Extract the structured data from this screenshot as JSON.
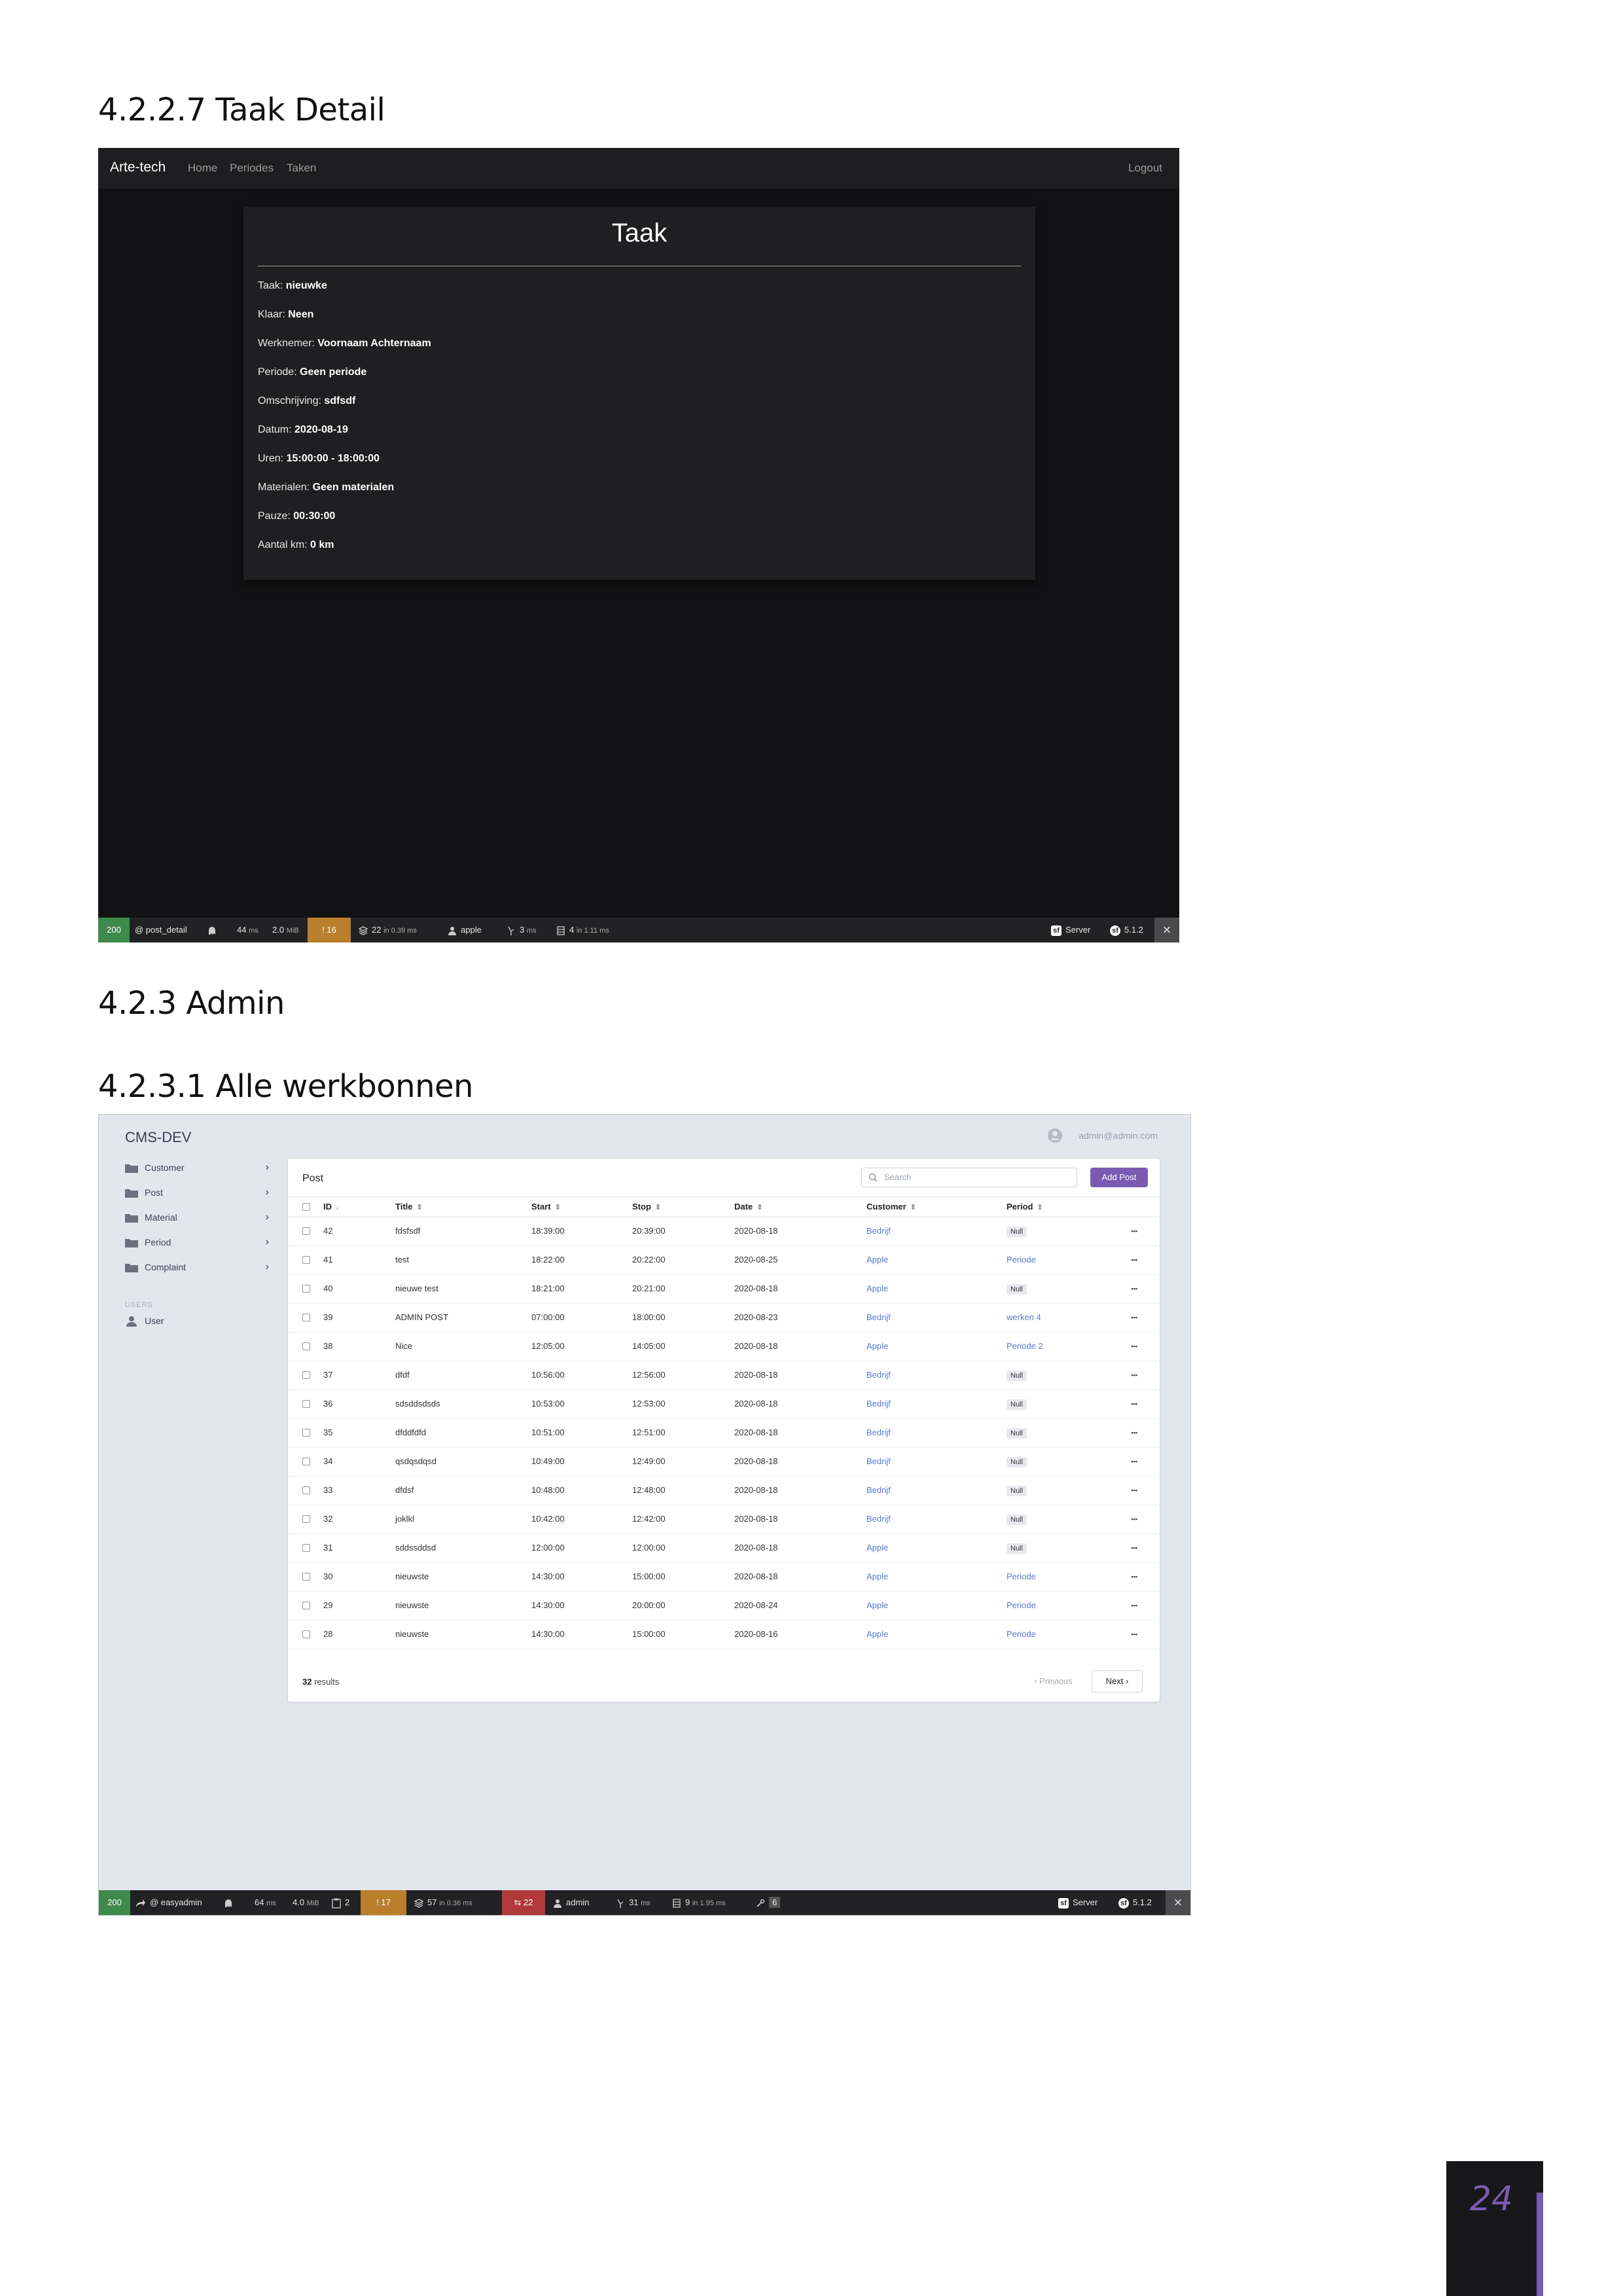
{
  "headings": {
    "taak_detail": "4.2.2.7 Taak Detail",
    "admin": "4.2.3 Admin",
    "alle_werkbonnen": "4.2.3.1 Alle werkbonnen"
  },
  "taak_app": {
    "brand": "Arte-tech",
    "nav": [
      "Home",
      "Periodes",
      "Taken"
    ],
    "logout": "Logout",
    "card_title": "Taak",
    "fields": [
      {
        "label": "Taak:",
        "value": "nieuwke"
      },
      {
        "label": "Klaar:",
        "value": "Neen"
      },
      {
        "label": "Werknemer:",
        "value": "Voornaam Achternaam"
      },
      {
        "label": "Periode:",
        "value": "Geen periode"
      },
      {
        "label": "Omschrijving:",
        "value": "sdfsdf"
      },
      {
        "label": "Datum:",
        "value": "2020-08-19"
      },
      {
        "label": "Uren:",
        "value": "15:00:00 - 18:00:00"
      },
      {
        "label": "Materialen:",
        "value": "Geen materialen"
      },
      {
        "label": "Pauze:",
        "value": "00:30:00"
      },
      {
        "label": "Aantal km:",
        "value": "0 km"
      }
    ],
    "toolbar": {
      "status": "200",
      "route": "@ post_detail",
      "time": "44",
      "time_unit": "ms",
      "memory": "2.0",
      "memory_unit": "MiB",
      "warnings": "16",
      "cache": "22",
      "cache_suffix": "in 0.39 ms",
      "user": "apple",
      "render": "3",
      "render_unit": "ms",
      "db": "4",
      "db_suffix": "in 1.11 ms",
      "server": "Server",
      "version": "5.1.2"
    }
  },
  "admin_app": {
    "title": "CMS-DEV",
    "user_email": "admin@admin.com",
    "menu": [
      "Customer",
      "Post",
      "Material",
      "Period",
      "Complaint"
    ],
    "users_section": "USERS",
    "users_item": "User",
    "panel_title": "Post",
    "search_placeholder": "Search",
    "add_button": "Add Post",
    "columns": [
      "ID",
      "Title",
      "Start",
      "Stop",
      "Date",
      "Customer",
      "Period"
    ],
    "rows": [
      {
        "id": "42",
        "title": "fdsfsdf",
        "start": "18:39:00",
        "stop": "20:39:00",
        "date": "2020-08-18",
        "customer": "Bedrijf",
        "period": "Null"
      },
      {
        "id": "41",
        "title": "test",
        "start": "18:22:00",
        "stop": "20:22:00",
        "date": "2020-08-25",
        "customer": "Apple",
        "period": "Periode"
      },
      {
        "id": "40",
        "title": "nieuwe test",
        "start": "18:21:00",
        "stop": "20:21:00",
        "date": "2020-08-18",
        "customer": "Apple",
        "period": "Null"
      },
      {
        "id": "39",
        "title": "ADMIN POST",
        "start": "07:00:00",
        "stop": "18:00:00",
        "date": "2020-08-23",
        "customer": "Bedrijf",
        "period": "werken 4"
      },
      {
        "id": "38",
        "title": "Nice",
        "start": "12:05:00",
        "stop": "14:05:00",
        "date": "2020-08-18",
        "customer": "Apple",
        "period": "Periode 2"
      },
      {
        "id": "37",
        "title": "dfdf",
        "start": "10:56:00",
        "stop": "12:56:00",
        "date": "2020-08-18",
        "customer": "Bedrijf",
        "period": "Null"
      },
      {
        "id": "36",
        "title": "sdsddsdsds",
        "start": "10:53:00",
        "stop": "12:53:00",
        "date": "2020-08-18",
        "customer": "Bedrijf",
        "period": "Null"
      },
      {
        "id": "35",
        "title": "dfddfdfd",
        "start": "10:51:00",
        "stop": "12:51:00",
        "date": "2020-08-18",
        "customer": "Bedrijf",
        "period": "Null"
      },
      {
        "id": "34",
        "title": "qsdqsdqsd",
        "start": "10:49:00",
        "stop": "12:49:00",
        "date": "2020-08-18",
        "customer": "Bedrijf",
        "period": "Null"
      },
      {
        "id": "33",
        "title": "dfdsf",
        "start": "10:48:00",
        "stop": "12:48:00",
        "date": "2020-08-18",
        "customer": "Bedrijf",
        "period": "Null"
      },
      {
        "id": "32",
        "title": "joklkl",
        "start": "10:42:00",
        "stop": "12:42:00",
        "date": "2020-08-18",
        "customer": "Bedrijf",
        "period": "Null"
      },
      {
        "id": "31",
        "title": "sddssddsd",
        "start": "12:00:00",
        "stop": "12:00:00",
        "date": "2020-08-18",
        "customer": "Apple",
        "period": "Null"
      },
      {
        "id": "30",
        "title": "nieuwste",
        "start": "14:30:00",
        "stop": "15:00:00",
        "date": "2020-08-18",
        "customer": "Apple",
        "period": "Periode"
      },
      {
        "id": "29",
        "title": "nieuwste",
        "start": "14:30:00",
        "stop": "20:00:00",
        "date": "2020-08-24",
        "customer": "Apple",
        "period": "Periode"
      },
      {
        "id": "28",
        "title": "nieuwste",
        "start": "14:30:00",
        "stop": "15:00:00",
        "date": "2020-08-16",
        "customer": "Apple",
        "period": "Periode"
      }
    ],
    "results_count": "32",
    "results_label": "results",
    "prev_label": "Previous",
    "next_label": "Next",
    "toolbar": {
      "status": "200",
      "route": "@ easyadmin",
      "time": "64",
      "time_unit": "ms",
      "memory": "4.0",
      "memory_unit": "MiB",
      "forms": "2",
      "warnings": "17",
      "cache": "57",
      "cache_suffix": "in 0.36 ms",
      "errors": "22",
      "user": "admin",
      "render": "31",
      "render_unit": "ms",
      "db": "9",
      "db_suffix": "in 1.95 ms",
      "twig": "6",
      "server": "Server",
      "version": "5.1.2"
    }
  },
  "page_number": "24"
}
